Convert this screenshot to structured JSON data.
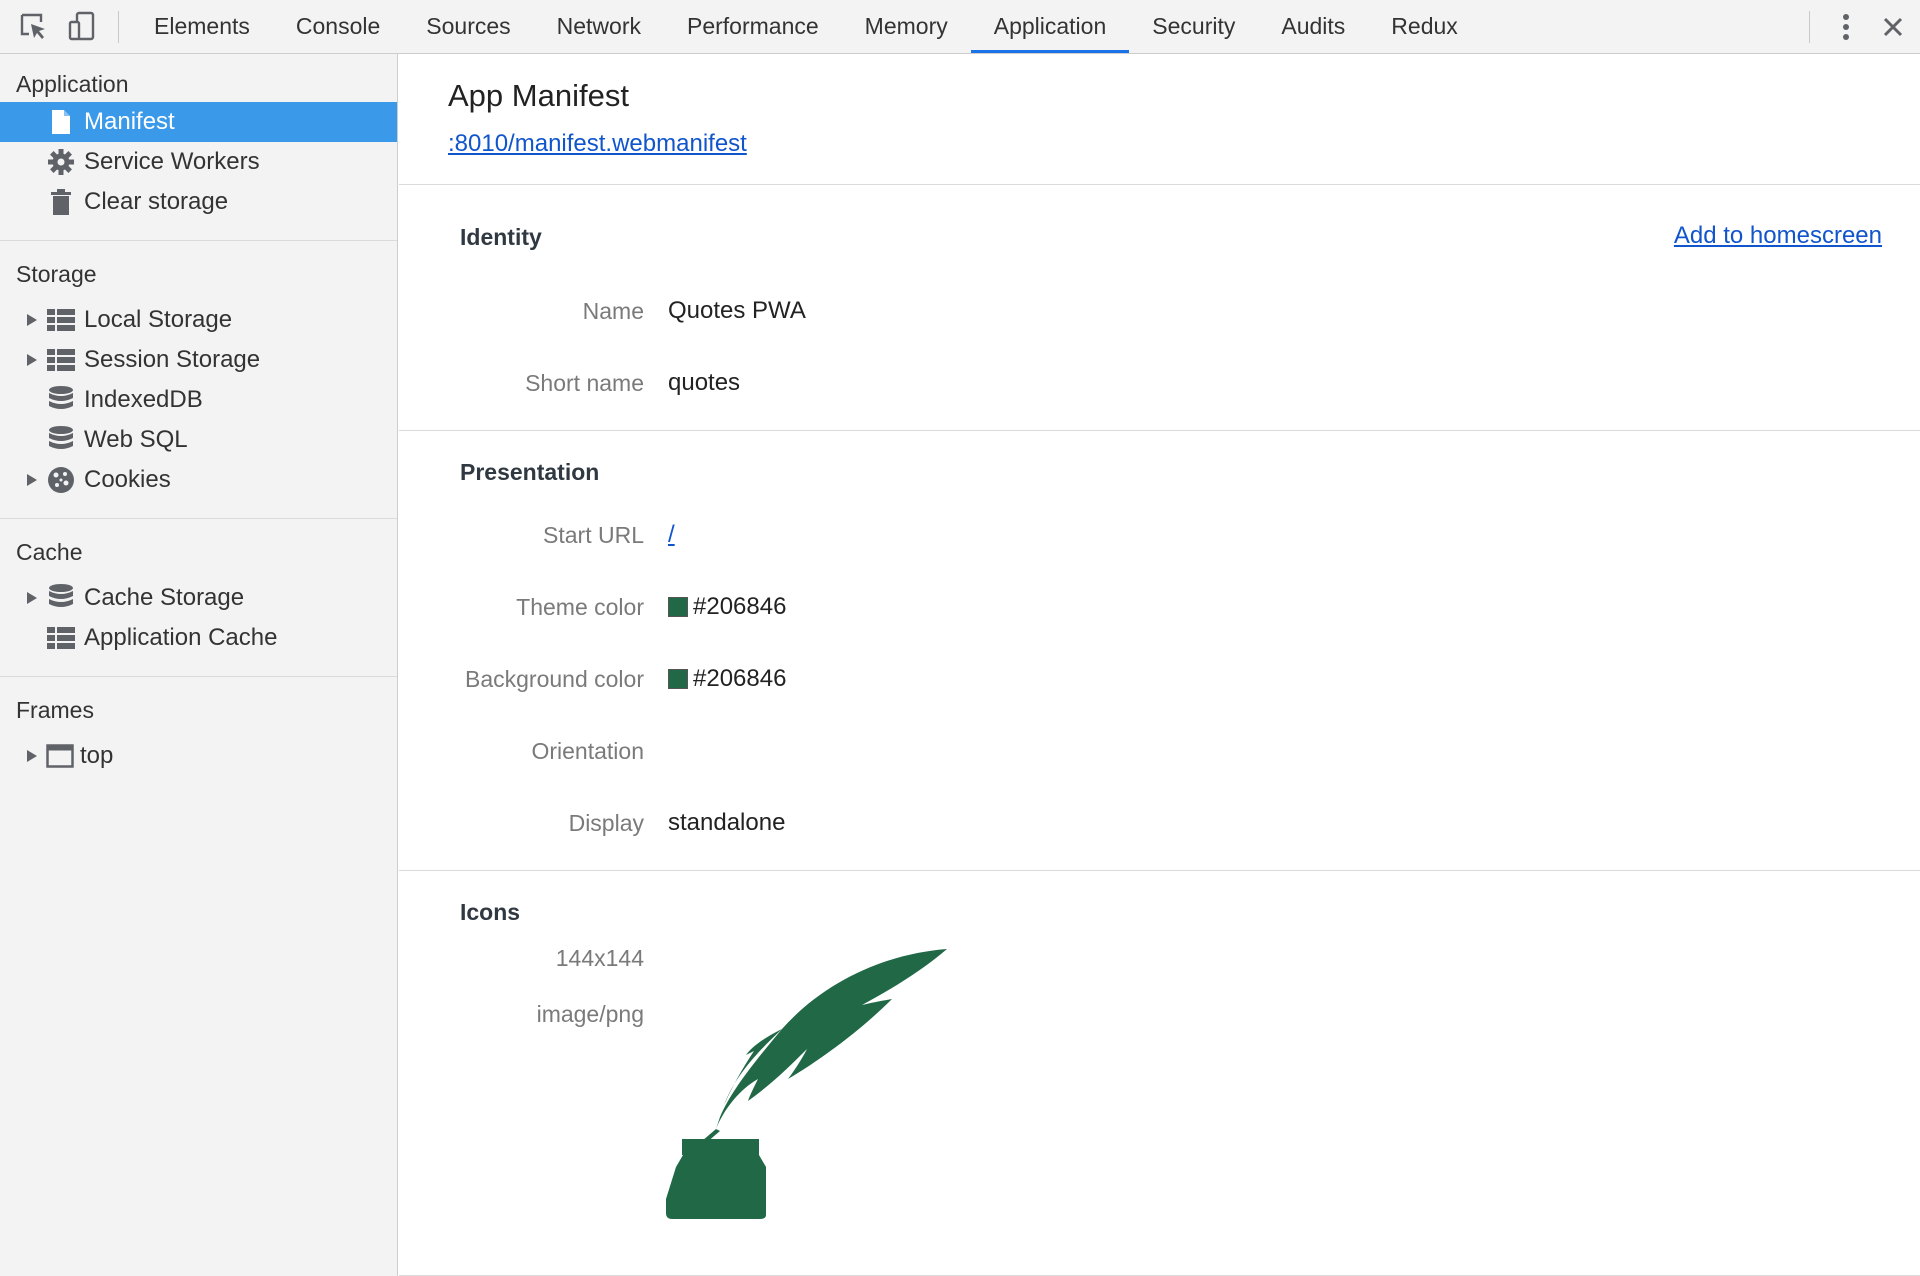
{
  "toolbar": {
    "tabs": [
      "Elements",
      "Console",
      "Sources",
      "Network",
      "Performance",
      "Memory",
      "Application",
      "Security",
      "Audits",
      "Redux"
    ],
    "active_tab": "Application",
    "accent": "#1a73e8"
  },
  "sidebar": {
    "application": {
      "heading": "Application",
      "items": [
        "Manifest",
        "Service Workers",
        "Clear storage"
      ],
      "selected": "Manifest"
    },
    "storage": {
      "heading": "Storage",
      "items": [
        "Local Storage",
        "Session Storage",
        "IndexedDB",
        "Web SQL",
        "Cookies"
      ]
    },
    "cache": {
      "heading": "Cache",
      "items": [
        "Cache Storage",
        "Application Cache"
      ]
    },
    "frames": {
      "heading": "Frames",
      "items": [
        "top"
      ]
    },
    "selected_color": "#3b99ea"
  },
  "main": {
    "title": "App Manifest",
    "manifest_url": ":8010/manifest.webmanifest",
    "identity": {
      "title": "Identity",
      "add_to_homescreen": "Add to homescreen",
      "name_label": "Name",
      "name_value": "Quotes PWA",
      "short_name_label": "Short name",
      "short_name_value": "quotes"
    },
    "presentation": {
      "title": "Presentation",
      "start_url_label": "Start URL",
      "start_url_value": "/",
      "theme_color_label": "Theme color",
      "theme_color_value": "#206846",
      "background_color_label": "Background color",
      "background_color_value": "#206846",
      "orientation_label": "Orientation",
      "orientation_value": "",
      "display_label": "Display",
      "display_value": "standalone"
    },
    "icons": {
      "title": "Icons",
      "size": "144x144",
      "type": "image/png",
      "icon_name": "quill-inkwell-icon",
      "icon_color": "#206846"
    }
  }
}
